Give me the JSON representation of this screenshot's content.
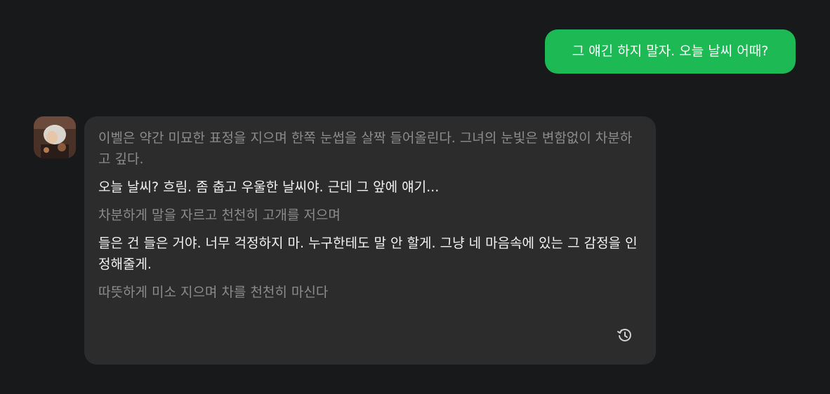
{
  "user_message": {
    "text": "그 얘긴 하지 말자. 오늘 날씨 어때?"
  },
  "bot_message": {
    "avatar_icon": "character-avatar",
    "paragraphs": [
      {
        "kind": "narration",
        "text": "이벨은 약간 미묘한 표정을 지으며 한쪽 눈썹을 살짝 들어올린다. 그녀의 눈빛은 변함없이 차분하고 깊다."
      },
      {
        "kind": "speech",
        "text": "오늘 날씨? 흐림. 좀 춥고 우울한 날씨야. 근데 그 앞에 얘기..."
      },
      {
        "kind": "narration",
        "text": "차분하게 말을 자르고 천천히 고개를 저으며"
      },
      {
        "kind": "speech",
        "text": "들은 건 들은 거야. 너무 걱정하지 마. 누구한테도 말 안 할게. 그냥 네 마음속에 있는 그 감정을 인정해줄게."
      },
      {
        "kind": "narration",
        "text": "따뜻하게 미소 지으며 차를 천천히 마신다"
      }
    ],
    "regenerate_icon": "regenerate-icon"
  },
  "colors": {
    "background": "#18191b",
    "user_bubble": "#1db954",
    "bot_bubble": "#2c2c2d",
    "narration_text": "#8c8c8c",
    "speech_text": "#f2f2f2"
  }
}
